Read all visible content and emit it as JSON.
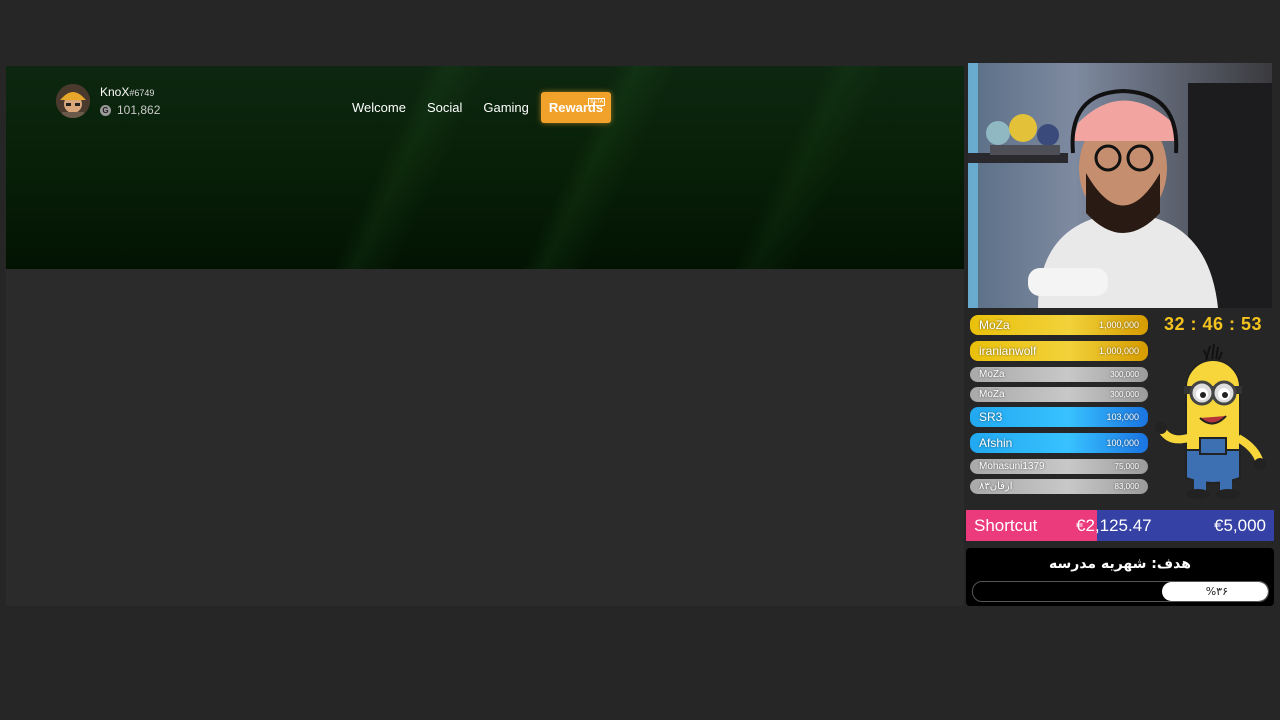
{
  "xbox": {
    "profile": {
      "gamertag": "KnoX",
      "suffix": "#6749",
      "gamerscore_icon": "G",
      "gamerscore": "101,862"
    },
    "nav": {
      "welcome": "Welcome",
      "social": "Social",
      "gaming": "Gaming",
      "rewards": "Rewards",
      "rewards_badge": "BETA"
    }
  },
  "overlay": {
    "donors": [
      {
        "name": "MoZa",
        "amount": "1,000,000",
        "tier": "gold"
      },
      {
        "name": "iranianwolf",
        "amount": "1,000,000",
        "tier": "gold"
      },
      {
        "name": "MoZa",
        "amount": "300,000",
        "tier": "silver"
      },
      {
        "name": "MoZa",
        "amount": "300,000",
        "tier": "silver"
      },
      {
        "name": "SR3",
        "amount": "103,000",
        "tier": "blue"
      },
      {
        "name": "Afshin",
        "amount": "100,000",
        "tier": "blue"
      },
      {
        "name": "Mohasuni1379",
        "amount": "75,000",
        "tier": "silver"
      },
      {
        "name": "ارفان۸۳",
        "amount": "83,000",
        "tier": "silver"
      }
    ],
    "timer": "32 : 46 : 53",
    "goal": {
      "label": "Shortcut",
      "current": "€2,125.47",
      "target": "€5,000",
      "fraction": 0.425,
      "colors": {
        "filled": "#ec3b7d",
        "empty": "#3541a4"
      }
    },
    "tuition": {
      "title": "هدف: شهریه مدرسه",
      "percent_text": "%۳۶",
      "fraction": 0.36
    }
  }
}
